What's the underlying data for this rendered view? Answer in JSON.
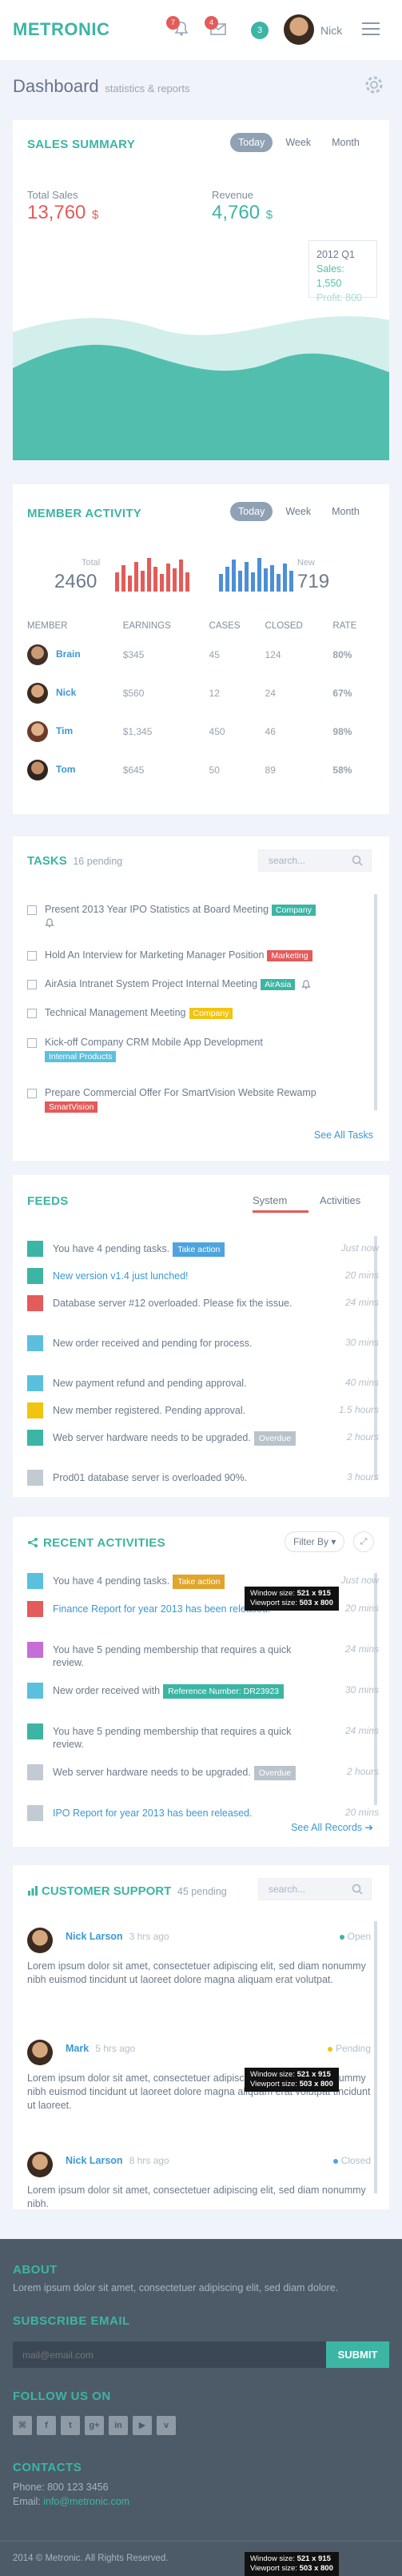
{
  "header": {
    "logo": "METRONIC",
    "notif_count": "7",
    "inbox_count": "4",
    "tasks_count": "3",
    "user_name": "Nick"
  },
  "page": {
    "title": "Dashboard",
    "subtitle": "statistics & reports"
  },
  "sales": {
    "title": "SALES SUMMARY",
    "tabs": [
      "Today",
      "Week",
      "Month"
    ],
    "total_label": "Total Sales",
    "total_value": "13,760",
    "total_unit": "$",
    "revenue_label": "Revenue",
    "revenue_value": "4,760",
    "revenue_unit": "$",
    "tooltip_period": "2012 Q1",
    "tooltip_sales": "Sales: 1,550",
    "tooltip_profit": "Profit: 800",
    "colors": {
      "red": "#e35b5a",
      "teal": "#3cb5a4",
      "wave_dark": "#52bfae",
      "wave_light": "#d3efeb"
    }
  },
  "members": {
    "title": "MEMBER ACTIVITY",
    "tabs": [
      "Today",
      "Week",
      "Month"
    ],
    "total_label": "Total",
    "total_value": "2460",
    "new_label": "New",
    "new_value": "719",
    "total_bars": [
      0.55,
      0.75,
      0.45,
      0.85,
      0.6,
      0.95,
      0.7,
      0.5,
      0.8,
      0.65,
      0.9,
      0.55
    ],
    "new_bars": [
      0.5,
      0.7,
      0.9,
      0.6,
      0.85,
      0.55,
      0.95,
      0.65,
      0.75,
      0.5,
      0.8,
      0.6
    ],
    "columns": [
      "MEMBER",
      "EARNINGS",
      "CASES",
      "CLOSED",
      "RATE"
    ],
    "rows": [
      {
        "name": "Brain",
        "earnings": "$345",
        "cases": "45",
        "closed": "124",
        "rate": "80%"
      },
      {
        "name": "Nick",
        "earnings": "$560",
        "cases": "12",
        "closed": "24",
        "rate": "67%"
      },
      {
        "name": "Tim",
        "earnings": "$1,345",
        "cases": "450",
        "closed": "46",
        "rate": "98%"
      },
      {
        "name": "Tom",
        "earnings": "$645",
        "cases": "50",
        "closed": "89",
        "rate": "58%"
      }
    ]
  },
  "tasks": {
    "title": "TASKS",
    "pending": "16 pending",
    "search_placeholder": "search...",
    "items": [
      {
        "text": "Present 2013 Year IPO Statistics at Board Meeting",
        "tag": "Company",
        "tag_color": "#3cb5a4",
        "bell": true
      },
      {
        "text": "Hold An Interview for Marketing Manager Position",
        "tag": "Marketing",
        "tag_color": "#e35b5a",
        "bell": false
      },
      {
        "text": "AirAsia Intranet System Project Internal Meeting",
        "tag": "AirAsia",
        "tag_color": "#3cb5a4",
        "bell": true
      },
      {
        "text": "Technical Management Meeting",
        "tag": "Company",
        "tag_color": "#f1c40f",
        "bell": false
      },
      {
        "text": "Kick-off Company CRM Mobile App Development",
        "tag": "Internal Products",
        "tag_color": "#5bc0de",
        "bell": false
      },
      {
        "text": "Prepare Commercial Offer For SmartVision Website Rewamp",
        "tag": "SmartVision",
        "tag_color": "#e35b5a",
        "bell": false
      }
    ],
    "see_all": "See All Tasks"
  },
  "feeds": {
    "title": "FEEDS",
    "tabs": [
      "System",
      "Activities"
    ],
    "items": [
      {
        "text": "You have 4 pending tasks.",
        "badge": "Take action",
        "badge_color": "#4da4e0",
        "icon_color": "#3cb5a4",
        "time": "Just now",
        "link": false
      },
      {
        "text": "New version v1.4 just lunched!",
        "badge": "",
        "icon_color": "#3cb5a4",
        "time": "20 mins",
        "link": true
      },
      {
        "text": "Database server #12 overloaded. Please fix the issue.",
        "badge": "",
        "icon_color": "#e35b5a",
        "time": "24 mins",
        "link": false
      },
      {
        "text": "New order received and pending for process.",
        "badge": "",
        "icon_color": "#5bc0de",
        "time": "30 mins",
        "link": false
      },
      {
        "text": "New payment refund and pending approval.",
        "badge": "",
        "icon_color": "#5bc0de",
        "time": "40 mins",
        "link": false
      },
      {
        "text": "New member registered. Pending approval.",
        "badge": "",
        "icon_color": "#f1c40f",
        "time": "1.5 hours",
        "link": false
      },
      {
        "text": "Web server hardware needs to be upgraded.",
        "badge": "Overdue",
        "badge_color": "#bac3cc",
        "icon_color": "#3cb5a4",
        "time": "2 hours",
        "link": false
      },
      {
        "text": "Prod01 database server is overloaded 90%.",
        "badge": "",
        "icon_color": "#c2cad3",
        "time": "3 hours",
        "link": false
      }
    ]
  },
  "recent": {
    "title": "RECENT ACTIVITIES",
    "filter": "Filter By",
    "items": [
      {
        "text": "You have 4 pending tasks.",
        "badge": "Take action",
        "badge_color": "#e0a52b",
        "icon_color": "#5bc0de",
        "time": "Just now",
        "link": false
      },
      {
        "text": "Finance Report for year 2013 has been released.",
        "badge": "",
        "icon_color": "#e35b5a",
        "time": "20 mins",
        "link": true
      },
      {
        "text": "You have 5 pending membership that requires a quick review.",
        "badge": "",
        "icon_color": "#c66ed8",
        "time": "24 mins",
        "link": false
      },
      {
        "text": "New order received with",
        "badge": "Reference Number: DR23923",
        "badge_color": "#3cb5a4",
        "icon_color": "#5bc0de",
        "time": "30 mins",
        "link": false
      },
      {
        "text": "You have 5 pending membership that requires a quick review.",
        "badge": "",
        "icon_color": "#3cb5a4",
        "time": "24 mins",
        "link": false
      },
      {
        "text": "Web server hardware needs to be upgraded.",
        "badge": "Overdue",
        "badge_color": "#bac3cc",
        "icon_color": "#c2cad3",
        "time": "2 hours",
        "link": false
      },
      {
        "text": "IPO Report for year 2013 has been released.",
        "badge": "",
        "icon_color": "#c2cad3",
        "time": "20 mins",
        "link": true
      }
    ],
    "see_all": "See All Records"
  },
  "support": {
    "title": "CUSTOMER SUPPORT",
    "pending": "45 pending",
    "search_placeholder": "search...",
    "items": [
      {
        "name": "Nick Larson",
        "time": "3 hrs ago",
        "status": "Open",
        "status_color": "#3cb5a4",
        "body": "Lorem ipsum dolor sit amet, consectetuer adipiscing elit, sed diam nonummy nibh euismod tincidunt ut laoreet dolore magna aliquam erat volutpat."
      },
      {
        "name": "Mark",
        "time": "5 hrs ago",
        "status": "Pending",
        "status_color": "#f1c40f",
        "body": "Lorem ipsum dolor sit amet, consectetuer adipiscing elit, sed diam nonummy nibh euismod tincidunt ut laoreet dolore magna aliquam erat volutpat tincidunt ut laoreet."
      },
      {
        "name": "Nick Larson",
        "time": "8 hrs ago",
        "status": "Closed",
        "status_color": "#4da4e0",
        "body": "Lorem ipsum dolor sit amet, consectetuer adipiscing elit, sed diam nonummy nibh."
      }
    ]
  },
  "footer": {
    "about_title": "ABOUT",
    "about_text": "Lorem ipsum dolor sit amet, consectetuer adipiscing elit, sed diam dolore.",
    "subscribe_title": "SUBSCRIBE EMAIL",
    "email_placeholder": "mail@email.com",
    "submit": "SUBMIT",
    "follow_title": "FOLLOW US ON",
    "social": [
      "rss",
      "f",
      "t",
      "g+",
      "in",
      "yt",
      "v"
    ],
    "contacts_title": "CONTACTS",
    "phone": "Phone: 800 123 3456",
    "email_label": "Email:",
    "email": "info@metronic.com",
    "copyright": "2014 © Metronic. All Rights Reserved."
  },
  "window_tip": {
    "window_label": "Window size:",
    "window_value": "521 x 915",
    "viewport_label": "Viewport size:",
    "viewport_value": "503 x 800"
  }
}
